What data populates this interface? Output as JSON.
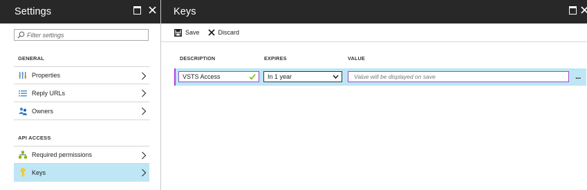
{
  "settings": {
    "title": "Settings",
    "filter_placeholder": "Filter settings",
    "sections": [
      {
        "label": "GENERAL",
        "items": [
          {
            "label": "Properties",
            "icon": "properties-icon"
          },
          {
            "label": "Reply URLs",
            "icon": "list-icon"
          },
          {
            "label": "Owners",
            "icon": "users-icon"
          }
        ]
      },
      {
        "label": "API ACCESS",
        "items": [
          {
            "label": "Required permissions",
            "icon": "permissions-icon"
          },
          {
            "label": "Keys",
            "icon": "key-icon",
            "selected": true
          }
        ]
      }
    ]
  },
  "keys": {
    "title": "Keys",
    "toolbar": {
      "save_label": "Save",
      "discard_label": "Discard"
    },
    "columns": {
      "description": "DESCRIPTION",
      "expires": "EXPIRES",
      "value": "VALUE"
    },
    "row": {
      "description": "VSTS Access",
      "expires": "In 1 year",
      "value_placeholder": "Value will be displayed on save",
      "more": "..."
    }
  },
  "colors": {
    "header_bg": "#282828",
    "selected_bg": "#bfe6f4",
    "accent_border": "#a93fd8"
  }
}
